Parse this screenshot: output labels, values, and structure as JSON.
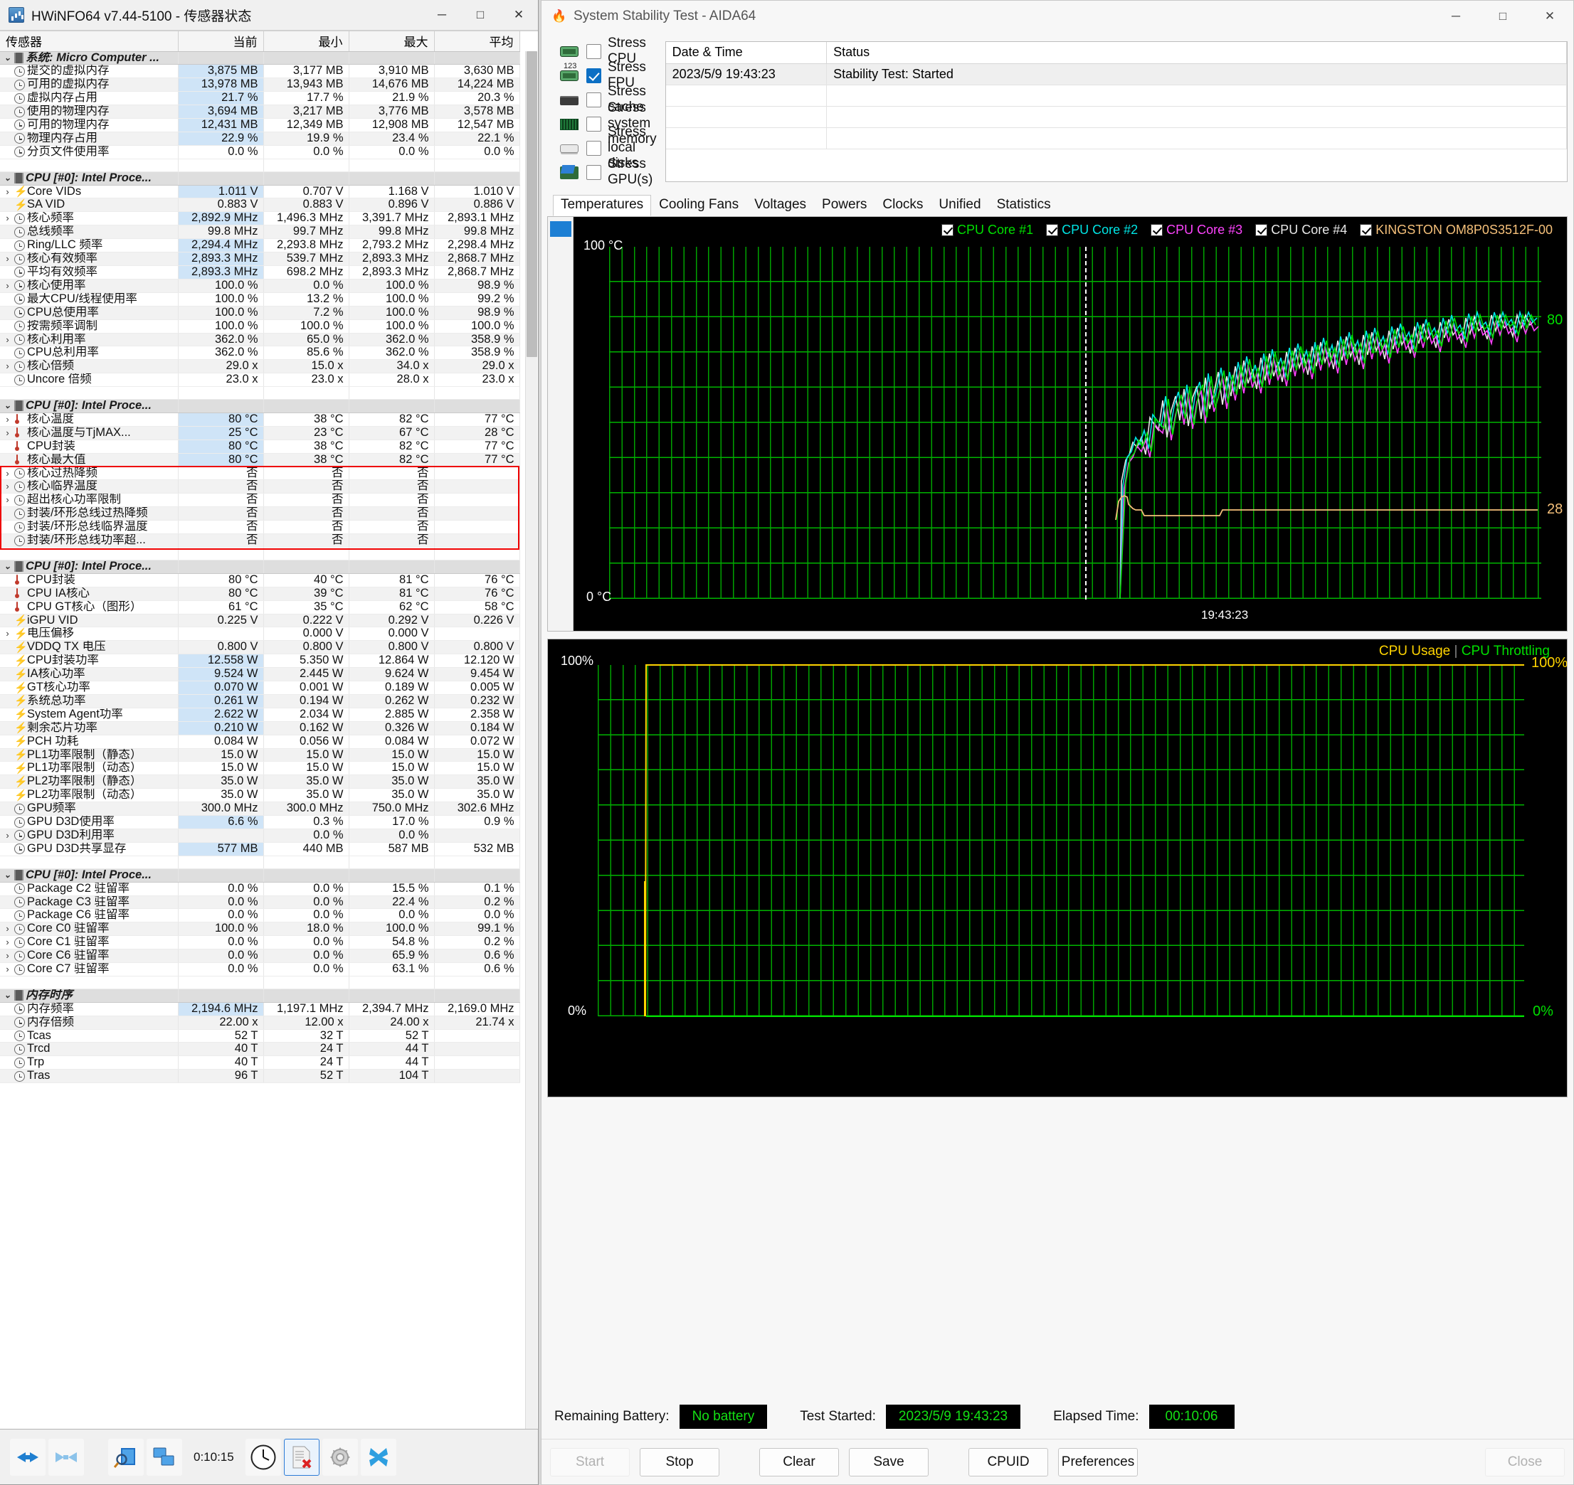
{
  "hwinfo": {
    "title": "HWiNFO64 v7.44-5100 - 传感器状态",
    "window_buttons": {
      "minimize": "─",
      "maximize": "□",
      "close": "✕"
    },
    "columns": [
      "传感器",
      "当前",
      "最小",
      "最大",
      "平均"
    ],
    "toolbar": {
      "elapsed": "0:10:15"
    },
    "rows": [
      {
        "type": "group",
        "icon": "chip-icon",
        "name": "系统: Micro Computer ..."
      },
      {
        "type": "row",
        "icon": "clock-icon",
        "name": "提交的虚拟内存",
        "cur": "3,875 MB",
        "min": "3,177 MB",
        "max": "3,910 MB",
        "avg": "3,630 MB",
        "hl": true
      },
      {
        "type": "row",
        "icon": "clock-icon",
        "name": "可用的虚拟内存",
        "cur": "13,978 MB",
        "min": "13,943 MB",
        "max": "14,676 MB",
        "avg": "14,224 MB",
        "hl": true
      },
      {
        "type": "row",
        "icon": "clock-icon",
        "name": "虚拟内存占用",
        "cur": "21.7 %",
        "min": "17.7 %",
        "max": "21.9 %",
        "avg": "20.3 %",
        "hl": true
      },
      {
        "type": "row",
        "icon": "clock-icon",
        "name": "使用的物理内存",
        "cur": "3,694 MB",
        "min": "3,217 MB",
        "max": "3,776 MB",
        "avg": "3,578 MB",
        "hl": true
      },
      {
        "type": "row",
        "icon": "clock-icon",
        "name": "可用的物理内存",
        "cur": "12,431 MB",
        "min": "12,349 MB",
        "max": "12,908 MB",
        "avg": "12,547 MB",
        "hl": true
      },
      {
        "type": "row",
        "icon": "clock-icon",
        "name": "物理内存占用",
        "cur": "22.9 %",
        "min": "19.9 %",
        "max": "23.4 %",
        "avg": "22.1 %",
        "hl": true
      },
      {
        "type": "row",
        "icon": "clock-icon",
        "name": "分页文件使用率",
        "cur": "0.0 %",
        "min": "0.0 %",
        "max": "0.0 %",
        "avg": "0.0 %"
      },
      {
        "type": "blank"
      },
      {
        "type": "group",
        "icon": "chip-icon",
        "name": "CPU [#0]: Intel Proce..."
      },
      {
        "type": "row",
        "icon": "bolt-icon",
        "chev": true,
        "name": "Core VIDs",
        "cur": "1.011 V",
        "min": "0.707 V",
        "max": "1.168 V",
        "avg": "1.010 V",
        "hl": true
      },
      {
        "type": "row",
        "icon": "bolt-icon",
        "name": "SA VID",
        "cur": "0.883 V",
        "min": "0.883 V",
        "max": "0.896 V",
        "avg": "0.886 V"
      },
      {
        "type": "row",
        "icon": "clock-icon",
        "chev": true,
        "name": "核心频率",
        "cur": "2,892.9 MHz",
        "min": "1,496.3 MHz",
        "max": "3,391.7 MHz",
        "avg": "2,893.1 MHz",
        "hl": true
      },
      {
        "type": "row",
        "icon": "clock-icon",
        "name": "总线频率",
        "cur": "99.8 MHz",
        "min": "99.7 MHz",
        "max": "99.8 MHz",
        "avg": "99.8 MHz"
      },
      {
        "type": "row",
        "icon": "clock-icon",
        "name": "Ring/LLC 频率",
        "cur": "2,294.4 MHz",
        "min": "2,293.8 MHz",
        "max": "2,793.2 MHz",
        "avg": "2,298.4 MHz",
        "hl": true
      },
      {
        "type": "row",
        "icon": "clock-icon",
        "chev": true,
        "name": "核心有效频率",
        "cur": "2,893.3 MHz",
        "min": "539.7 MHz",
        "max": "2,893.3 MHz",
        "avg": "2,868.7 MHz",
        "hl": true
      },
      {
        "type": "row",
        "icon": "clock-icon",
        "name": "平均有效频率",
        "cur": "2,893.3 MHz",
        "min": "698.2 MHz",
        "max": "2,893.3 MHz",
        "avg": "2,868.7 MHz",
        "hl": true
      },
      {
        "type": "row",
        "icon": "clock-icon",
        "chev": true,
        "name": "核心使用率",
        "cur": "100.0 %",
        "min": "0.0 %",
        "max": "100.0 %",
        "avg": "98.9 %"
      },
      {
        "type": "row",
        "icon": "clock-icon",
        "name": "最大CPU/线程使用率",
        "cur": "100.0 %",
        "min": "13.2 %",
        "max": "100.0 %",
        "avg": "99.2 %"
      },
      {
        "type": "row",
        "icon": "clock-icon",
        "name": "CPU总使用率",
        "cur": "100.0 %",
        "min": "7.2 %",
        "max": "100.0 %",
        "avg": "98.9 %"
      },
      {
        "type": "row",
        "icon": "clock-icon",
        "name": "按需频率调制",
        "cur": "100.0 %",
        "min": "100.0 %",
        "max": "100.0 %",
        "avg": "100.0 %"
      },
      {
        "type": "row",
        "icon": "clock-icon",
        "chev": true,
        "name": "核心利用率",
        "cur": "362.0 %",
        "min": "65.0 %",
        "max": "362.0 %",
        "avg": "358.9 %"
      },
      {
        "type": "row",
        "icon": "clock-icon",
        "name": "CPU总利用率",
        "cur": "362.0 %",
        "min": "85.6 %",
        "max": "362.0 %",
        "avg": "358.9 %"
      },
      {
        "type": "row",
        "icon": "clock-icon",
        "chev": true,
        "name": "核心倍频",
        "cur": "29.0 x",
        "min": "15.0 x",
        "max": "34.0 x",
        "avg": "29.0 x"
      },
      {
        "type": "row",
        "icon": "clock-icon",
        "name": "Uncore 倍频",
        "cur": "23.0 x",
        "min": "23.0 x",
        "max": "28.0 x",
        "avg": "23.0 x"
      },
      {
        "type": "blank"
      },
      {
        "type": "group",
        "icon": "chip-icon",
        "name": "CPU [#0]: Intel Proce..."
      },
      {
        "type": "row",
        "icon": "thermo-icon",
        "chev": true,
        "name": "核心温度",
        "cur": "80 °C",
        "min": "38 °C",
        "max": "82 °C",
        "avg": "77 °C",
        "hl": true
      },
      {
        "type": "row",
        "icon": "thermo-icon",
        "chev": true,
        "name": "核心温度与TjMAX...",
        "cur": "25 °C",
        "min": "23 °C",
        "max": "67 °C",
        "avg": "28 °C",
        "hl": true
      },
      {
        "type": "row",
        "icon": "thermo-icon",
        "name": "CPU封装",
        "cur": "80 °C",
        "min": "38 °C",
        "max": "82 °C",
        "avg": "77 °C",
        "hl": true
      },
      {
        "type": "row",
        "icon": "thermo-icon",
        "name": "核心最大值",
        "cur": "80 °C",
        "min": "38 °C",
        "max": "82 °C",
        "avg": "77 °C",
        "hl": true
      },
      {
        "type": "row",
        "icon": "clock-icon",
        "chev": true,
        "name": "核心过热降频",
        "cur": "否",
        "min": "否",
        "max": "否",
        "avg": ""
      },
      {
        "type": "row",
        "icon": "clock-icon",
        "chev": true,
        "name": "核心临界温度",
        "cur": "否",
        "min": "否",
        "max": "否",
        "avg": ""
      },
      {
        "type": "row",
        "icon": "clock-icon",
        "chev": true,
        "name": "超出核心功率限制",
        "cur": "否",
        "min": "否",
        "max": "否",
        "avg": ""
      },
      {
        "type": "row",
        "icon": "clock-icon",
        "name": "封装/环形总线过热降频",
        "cur": "否",
        "min": "否",
        "max": "否",
        "avg": ""
      },
      {
        "type": "row",
        "icon": "clock-icon",
        "name": "封装/环形总线临界温度",
        "cur": "否",
        "min": "否",
        "max": "否",
        "avg": ""
      },
      {
        "type": "row",
        "icon": "clock-icon",
        "name": "封装/环形总线功率超...",
        "cur": "否",
        "min": "否",
        "max": "否",
        "avg": ""
      },
      {
        "type": "blank"
      },
      {
        "type": "group",
        "icon": "chip-icon",
        "name": "CPU [#0]: Intel Proce..."
      },
      {
        "type": "row",
        "icon": "thermo-icon",
        "name": "CPU封装",
        "cur": "80 °C",
        "min": "40 °C",
        "max": "81 °C",
        "avg": "76 °C"
      },
      {
        "type": "row",
        "icon": "thermo-icon",
        "name": "CPU IA核心",
        "cur": "80 °C",
        "min": "39 °C",
        "max": "81 °C",
        "avg": "76 °C"
      },
      {
        "type": "row",
        "icon": "thermo-icon",
        "name": "CPU GT核心（图形）",
        "cur": "61 °C",
        "min": "35 °C",
        "max": "62 °C",
        "avg": "58 °C"
      },
      {
        "type": "row",
        "icon": "bolt-icon",
        "name": "iGPU VID",
        "cur": "0.225 V",
        "min": "0.222 V",
        "max": "0.292 V",
        "avg": "0.226 V"
      },
      {
        "type": "row",
        "icon": "bolt-icon",
        "chev": true,
        "name": "电压偏移",
        "cur": "",
        "min": "0.000 V",
        "max": "0.000 V",
        "avg": ""
      },
      {
        "type": "row",
        "icon": "bolt-icon",
        "name": "VDDQ TX 电压",
        "cur": "0.800 V",
        "min": "0.800 V",
        "max": "0.800 V",
        "avg": "0.800 V"
      },
      {
        "type": "row",
        "icon": "bolt-icon",
        "name": "CPU封装功率",
        "cur": "12.558 W",
        "min": "5.350 W",
        "max": "12.864 W",
        "avg": "12.120 W",
        "hl": true
      },
      {
        "type": "row",
        "icon": "bolt-icon",
        "name": "IA核心功率",
        "cur": "9.524 W",
        "min": "2.445 W",
        "max": "9.624 W",
        "avg": "9.454 W",
        "hl": true
      },
      {
        "type": "row",
        "icon": "bolt-icon",
        "name": "GT核心功率",
        "cur": "0.070 W",
        "min": "0.001 W",
        "max": "0.189 W",
        "avg": "0.005 W",
        "hl": true
      },
      {
        "type": "row",
        "icon": "bolt-icon",
        "name": "系统总功率",
        "cur": "0.261 W",
        "min": "0.194 W",
        "max": "0.262 W",
        "avg": "0.232 W",
        "hl": true
      },
      {
        "type": "row",
        "icon": "bolt-icon",
        "name": "System Agent功率",
        "cur": "2.622 W",
        "min": "2.034 W",
        "max": "2.885 W",
        "avg": "2.358 W",
        "hl": true
      },
      {
        "type": "row",
        "icon": "bolt-icon",
        "name": "剩余芯片功率",
        "cur": "0.210 W",
        "min": "0.162 W",
        "max": "0.326 W",
        "avg": "0.184 W",
        "hl": true
      },
      {
        "type": "row",
        "icon": "bolt-icon",
        "name": "PCH 功耗",
        "cur": "0.084 W",
        "min": "0.056 W",
        "max": "0.084 W",
        "avg": "0.072 W"
      },
      {
        "type": "row",
        "icon": "bolt-icon",
        "name": "PL1功率限制（静态）",
        "cur": "15.0 W",
        "min": "15.0 W",
        "max": "15.0 W",
        "avg": "15.0 W"
      },
      {
        "type": "row",
        "icon": "bolt-icon",
        "name": "PL1功率限制（动态）",
        "cur": "15.0 W",
        "min": "15.0 W",
        "max": "15.0 W",
        "avg": "15.0 W"
      },
      {
        "type": "row",
        "icon": "bolt-icon",
        "name": "PL2功率限制（静态）",
        "cur": "35.0 W",
        "min": "35.0 W",
        "max": "35.0 W",
        "avg": "35.0 W"
      },
      {
        "type": "row",
        "icon": "bolt-icon",
        "name": "PL2功率限制（动态）",
        "cur": "35.0 W",
        "min": "35.0 W",
        "max": "35.0 W",
        "avg": "35.0 W"
      },
      {
        "type": "row",
        "icon": "clock-icon",
        "name": "GPU频率",
        "cur": "300.0 MHz",
        "min": "300.0 MHz",
        "max": "750.0 MHz",
        "avg": "302.6 MHz"
      },
      {
        "type": "row",
        "icon": "clock-icon",
        "name": "GPU D3D使用率",
        "cur": "6.6 %",
        "min": "0.3 %",
        "max": "17.0 %",
        "avg": "0.9 %",
        "hl": true
      },
      {
        "type": "row",
        "icon": "clock-icon",
        "chev": true,
        "name": "GPU D3D利用率",
        "cur": "",
        "min": "0.0 %",
        "max": "0.0 %",
        "avg": ""
      },
      {
        "type": "row",
        "icon": "clock-icon",
        "name": "GPU D3D共享显存",
        "cur": "577 MB",
        "min": "440 MB",
        "max": "587 MB",
        "avg": "532 MB",
        "hl": true
      },
      {
        "type": "blank"
      },
      {
        "type": "group",
        "icon": "chip-icon",
        "name": "CPU [#0]: Intel Proce..."
      },
      {
        "type": "row",
        "icon": "clock-icon",
        "name": "Package C2 驻留率",
        "cur": "0.0 %",
        "min": "0.0 %",
        "max": "15.5 %",
        "avg": "0.1 %"
      },
      {
        "type": "row",
        "icon": "clock-icon",
        "name": "Package C3 驻留率",
        "cur": "0.0 %",
        "min": "0.0 %",
        "max": "22.4 %",
        "avg": "0.2 %"
      },
      {
        "type": "row",
        "icon": "clock-icon",
        "name": "Package C6 驻留率",
        "cur": "0.0 %",
        "min": "0.0 %",
        "max": "0.0 %",
        "avg": "0.0 %"
      },
      {
        "type": "row",
        "icon": "clock-icon",
        "chev": true,
        "name": "Core C0 驻留率",
        "cur": "100.0 %",
        "min": "18.0 %",
        "max": "100.0 %",
        "avg": "99.1 %"
      },
      {
        "type": "row",
        "icon": "clock-icon",
        "chev": true,
        "name": "Core C1 驻留率",
        "cur": "0.0 %",
        "min": "0.0 %",
        "max": "54.8 %",
        "avg": "0.2 %"
      },
      {
        "type": "row",
        "icon": "clock-icon",
        "chev": true,
        "name": "Core C6 驻留率",
        "cur": "0.0 %",
        "min": "0.0 %",
        "max": "65.9 %",
        "avg": "0.6 %"
      },
      {
        "type": "row",
        "icon": "clock-icon",
        "chev": true,
        "name": "Core C7 驻留率",
        "cur": "0.0 %",
        "min": "0.0 %",
        "max": "63.1 %",
        "avg": "0.6 %"
      },
      {
        "type": "blank"
      },
      {
        "type": "group",
        "icon": "chip-icon",
        "name": "内存时序"
      },
      {
        "type": "row",
        "icon": "clock-icon",
        "name": "内存频率",
        "cur": "2,194.6 MHz",
        "min": "1,197.1 MHz",
        "max": "2,394.7 MHz",
        "avg": "2,169.0 MHz",
        "hl": true
      },
      {
        "type": "row",
        "icon": "clock-icon",
        "name": "内存倍频",
        "cur": "22.00 x",
        "min": "12.00 x",
        "max": "24.00 x",
        "avg": "21.74 x"
      },
      {
        "type": "row",
        "icon": "clock-icon",
        "name": "Tcas",
        "cur": "52 T",
        "min": "32 T",
        "max": "52 T",
        "avg": ""
      },
      {
        "type": "row",
        "icon": "clock-icon",
        "name": "Trcd",
        "cur": "40 T",
        "min": "24 T",
        "max": "44 T",
        "avg": ""
      },
      {
        "type": "row",
        "icon": "clock-icon",
        "name": "Trp",
        "cur": "40 T",
        "min": "24 T",
        "max": "44 T",
        "avg": ""
      },
      {
        "type": "row",
        "icon": "clock-icon",
        "name": "Tras",
        "cur": "96 T",
        "min": "52 T",
        "max": "104 T",
        "avg": ""
      }
    ]
  },
  "aida": {
    "title": "System Stability Test - AIDA64",
    "window_buttons": {
      "minimize": "─",
      "maximize": "□",
      "close": "✕"
    },
    "stress_options": [
      {
        "label": "Stress CPU",
        "checked": false,
        "icon": "cpu-icon"
      },
      {
        "label": "Stress FPU",
        "checked": true,
        "icon": "fpu-icon"
      },
      {
        "label": "Stress cache",
        "checked": false,
        "icon": "cache-icon"
      },
      {
        "label": "Stress system memory",
        "checked": false,
        "icon": "memory-icon"
      },
      {
        "label": "Stress local disks",
        "checked": false,
        "icon": "disk-icon"
      },
      {
        "label": "Stress GPU(s)",
        "checked": false,
        "icon": "gpu-icon"
      }
    ],
    "log": {
      "headers": [
        "Date & Time",
        "Status"
      ],
      "rows": [
        {
          "datetime": "2023/5/9 19:43:23",
          "status": "Stability Test: Started"
        }
      ]
    },
    "tabs": [
      {
        "label": "Temperatures",
        "active": true
      },
      {
        "label": "Cooling Fans",
        "active": false
      },
      {
        "label": "Voltages",
        "active": false
      },
      {
        "label": "Powers",
        "active": false
      },
      {
        "label": "Clocks",
        "active": false
      },
      {
        "label": "Unified",
        "active": false
      },
      {
        "label": "Statistics",
        "active": false
      }
    ],
    "status": {
      "battery_label": "Remaining Battery:",
      "battery_value": "No battery",
      "started_label": "Test Started:",
      "started_value": "2023/5/9 19:43:23",
      "elapsed_label": "Elapsed Time:",
      "elapsed_value": "00:10:06"
    },
    "buttons": {
      "start": "Start",
      "stop": "Stop",
      "clear": "Clear",
      "save": "Save",
      "cpuid": "CPUID",
      "preferences": "Preferences",
      "close": "Close"
    }
  },
  "chart_data": [
    {
      "type": "line",
      "title": "Temperatures",
      "ylabel": "°C",
      "ylim": [
        0,
        100
      ],
      "y_tick_top": "100 °C",
      "y_tick_bottom": "0 °C",
      "xlabel": "19:43:23",
      "grid": true,
      "legend_position": "top-right",
      "legend": [
        {
          "name": "CPU Core #1",
          "color": "#00e000",
          "checked": true
        },
        {
          "name": "CPU Core #2",
          "color": "#00e5e5",
          "checked": true
        },
        {
          "name": "CPU Core #3",
          "color": "#ff44ff",
          "checked": true
        },
        {
          "name": "CPU Core #4",
          "color": "#e8e8e8",
          "checked": true
        },
        {
          "name": "KINGSTON OM8P0S3512F-00",
          "color": "#f5c07a",
          "checked": true
        }
      ],
      "current_values": [
        {
          "series": "CPU Core #1",
          "value": 80,
          "label": "80",
          "color": "#00e000"
        },
        {
          "series": "CPU Core #4",
          "value": 80,
          "label": "80",
          "color": "#e8e8e8"
        },
        {
          "series": "KINGSTON OM8P0S3512F-00",
          "value": 28,
          "label": "28",
          "color": "#f5c07a"
        }
      ]
    },
    {
      "type": "line",
      "title": "CPU Usage | CPU Throttling",
      "ylim": [
        0,
        100
      ],
      "y_tick_top": "100%",
      "y_tick_bottom": "0%",
      "grid": true,
      "legend_position": "top-right",
      "legend": [
        {
          "name": "CPU Usage",
          "color": "#ffd400",
          "checked": true
        },
        {
          "name": "CPU Throttling",
          "color": "#00e000",
          "checked": true
        }
      ],
      "current_values": [
        {
          "series": "CPU Usage",
          "value": 100,
          "label": "100%",
          "color": "#ffd400"
        },
        {
          "series": "CPU Throttling",
          "value": 0,
          "label": "0%",
          "color": "#00e000"
        }
      ]
    }
  ]
}
